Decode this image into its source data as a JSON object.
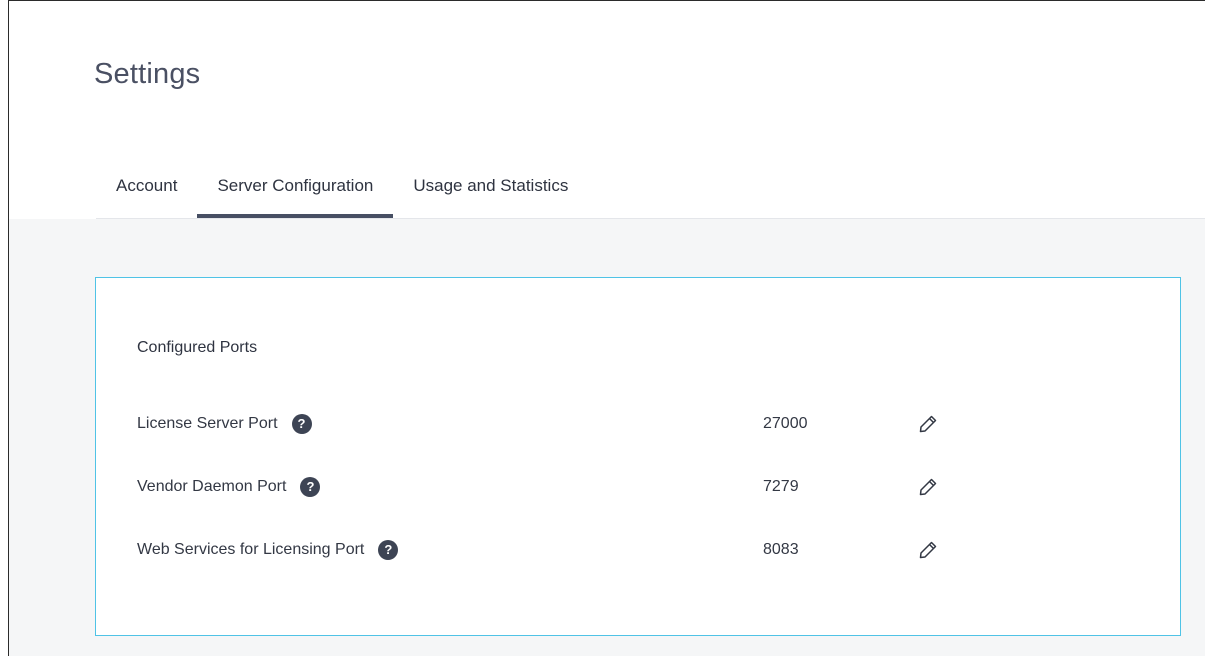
{
  "page": {
    "title": "Settings"
  },
  "tabs": [
    {
      "label": "Account",
      "active": false
    },
    {
      "label": "Server Configuration",
      "active": true
    },
    {
      "label": "Usage and Statistics",
      "active": false
    }
  ],
  "section": {
    "title": "Configured Ports",
    "rows": [
      {
        "label": "License Server Port",
        "value": "27000",
        "help_icon": "question-circle-icon",
        "edit_icon": "pencil-icon"
      },
      {
        "label": "Vendor Daemon Port",
        "value": "7279",
        "help_icon": "question-circle-icon",
        "edit_icon": "pencil-icon"
      },
      {
        "label": "Web Services for Licensing Port",
        "value": "8083",
        "help_icon": "question-circle-icon",
        "edit_icon": "pencil-icon"
      }
    ]
  },
  "colors": {
    "accent_border": "#4fc3e6",
    "active_tab_underline": "#474f63",
    "content_background": "#f5f6f7"
  }
}
